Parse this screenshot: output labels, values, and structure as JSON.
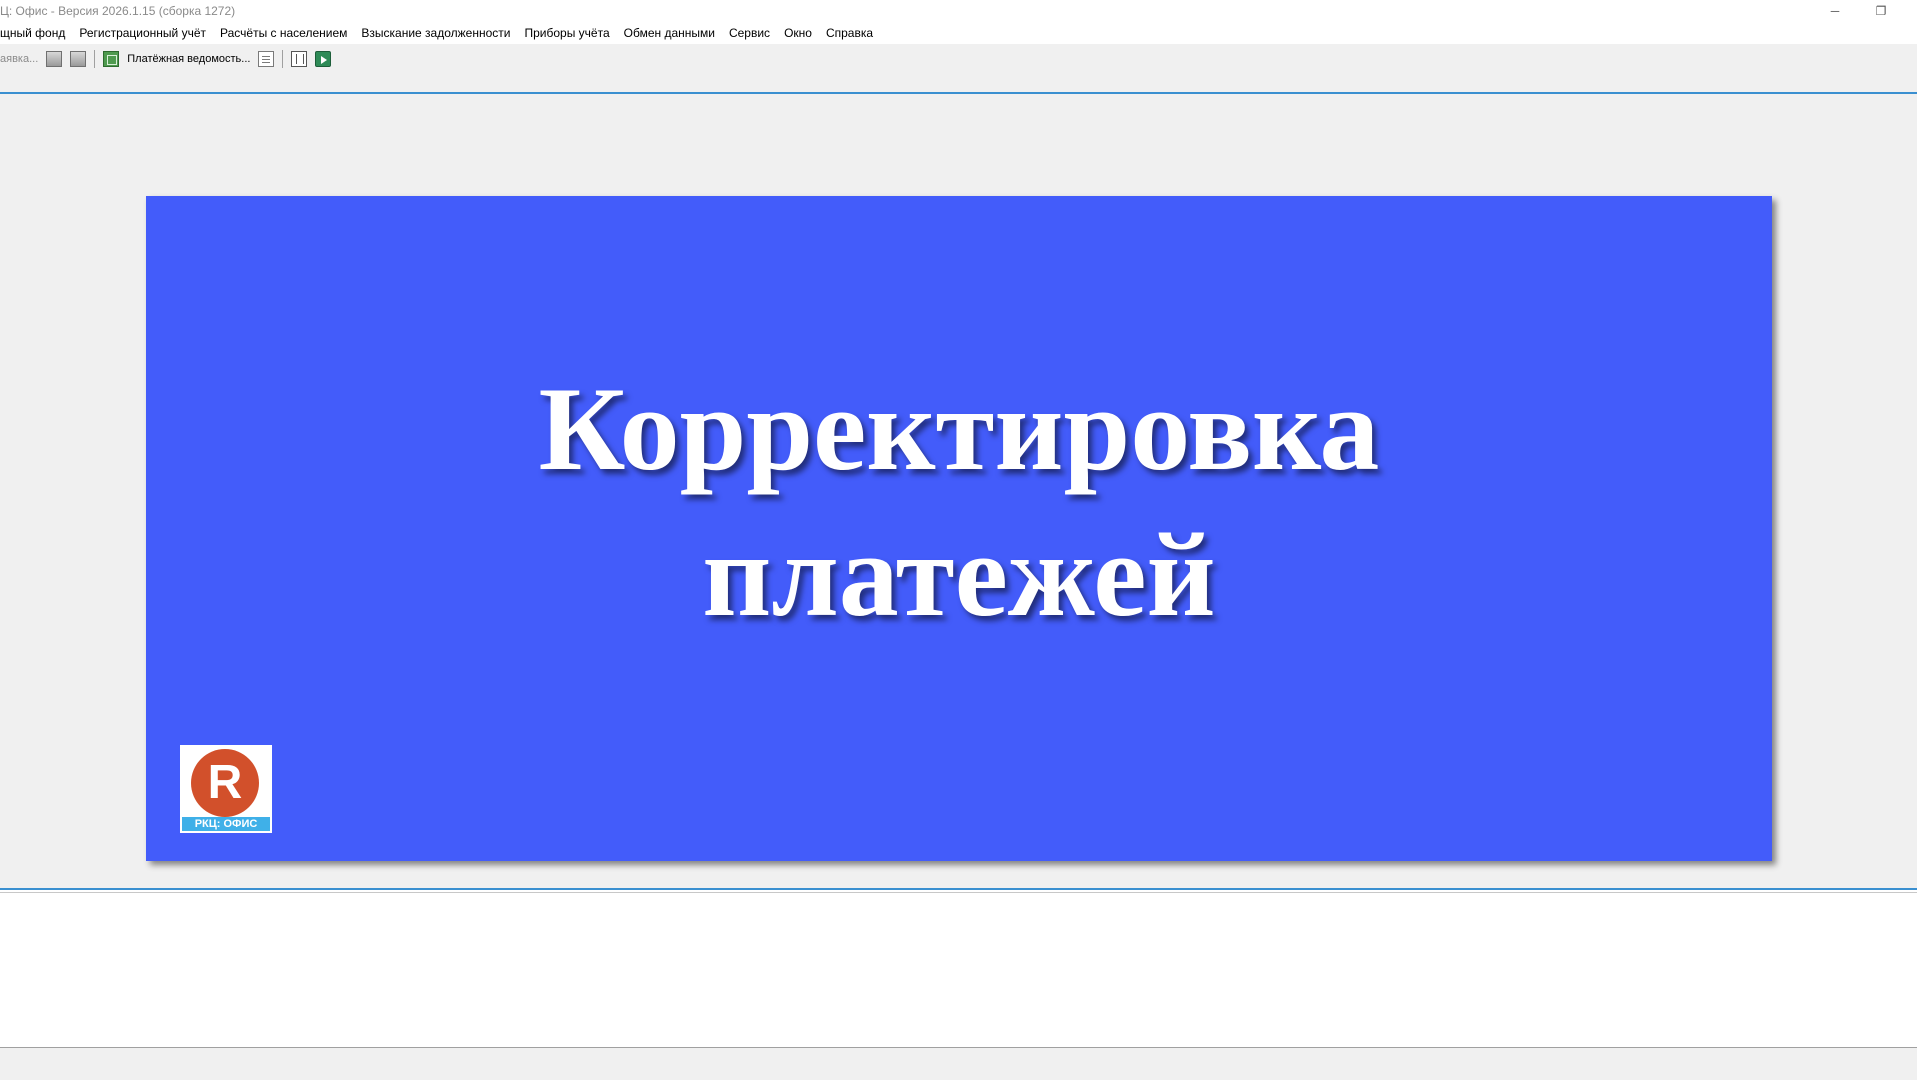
{
  "window": {
    "title": "Ц: Офис - Версия 2026.1.15 (сборка 1272)",
    "minimize_glyph": "─",
    "restore_glyph": "❐"
  },
  "menu": {
    "items": [
      "щный фонд",
      "Регистрационный учёт",
      "Расчёты с населением",
      "Взыскание задолженности",
      "Приборы учёта",
      "Обмен данными",
      "Сервис",
      "Окно",
      "Справка"
    ]
  },
  "toolbar": {
    "truncated_label": "аявка...",
    "payment_sheet_label": "Платёжная ведомость...",
    "icons": [
      "document-icon",
      "document-icon",
      "spreadsheet-icon",
      "report-icon",
      "table-icon",
      "excel-export-icon"
    ]
  },
  "banner": {
    "background_color": "#435cfa",
    "title_line1": "Корректировка",
    "title_line2": "платежей",
    "logo_letter": "R",
    "logo_label": "РКЦ: ОФИС"
  }
}
